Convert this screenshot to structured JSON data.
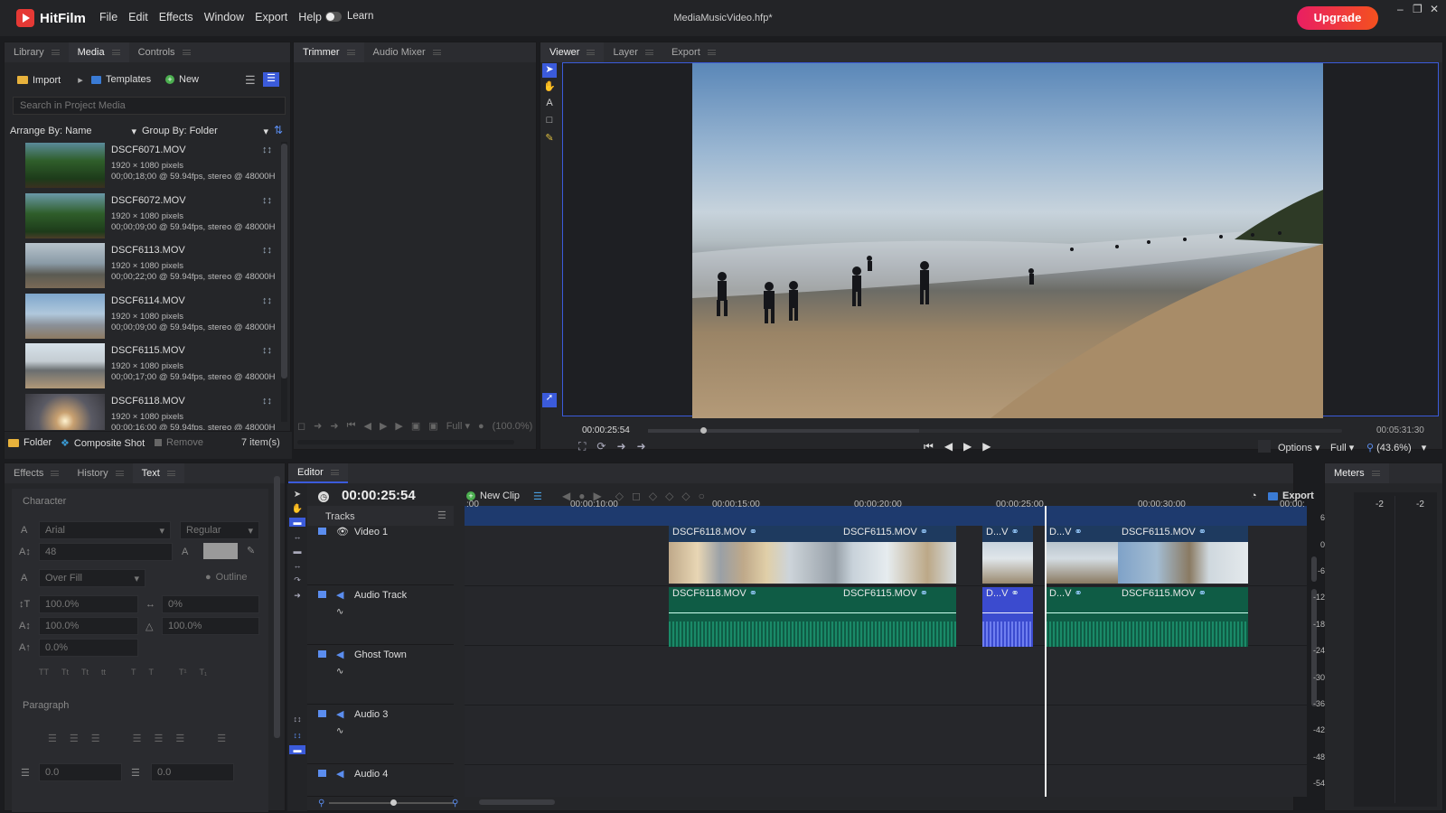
{
  "app": {
    "name": "HitFilm",
    "document": "MediaMusicVideo.hfp*",
    "upgrade": "Upgrade",
    "learn": "Learn"
  },
  "menu": [
    "File",
    "Edit",
    "Effects",
    "Window",
    "Export",
    "Help"
  ],
  "media_panel": {
    "tabs": [
      "Library",
      "Media",
      "Controls"
    ],
    "import": "Import",
    "templates": "Templates",
    "new": "New",
    "search_placeholder": "Search in Project Media",
    "arrange": "Arrange By: Name",
    "group": "Group By: Folder",
    "items": [
      {
        "name": "DSCF6071.MOV",
        "res": "1920 × 1080 pixels",
        "info": "00;00;18;00 @ 59.94fps, stereo @ 48000H"
      },
      {
        "name": "DSCF6072.MOV",
        "res": "1920 × 1080 pixels",
        "info": "00;00;09;00 @ 59.94fps, stereo @ 48000H"
      },
      {
        "name": "DSCF6113.MOV",
        "res": "1920 × 1080 pixels",
        "info": "00;00;22;00 @ 59.94fps, stereo @ 48000H"
      },
      {
        "name": "DSCF6114.MOV",
        "res": "1920 × 1080 pixels",
        "info": "00;00;09;00 @ 59.94fps, stereo @ 48000H"
      },
      {
        "name": "DSCF6115.MOV",
        "res": "1920 × 1080 pixels",
        "info": "00;00;17;00 @ 59.94fps, stereo @ 48000H"
      },
      {
        "name": "DSCF6118.MOV",
        "res": "1920 × 1080 pixels",
        "info": "00;00;16;00 @ 59.94fps, stereo @ 48000H"
      }
    ],
    "footer": {
      "folder": "Folder",
      "composite": "Composite Shot",
      "remove": "Remove",
      "count": "7 item(s)"
    }
  },
  "trimmer": {
    "tabs": [
      "Trimmer",
      "Audio Mixer"
    ],
    "quality": "Full",
    "zoom": "(100.0%)"
  },
  "viewer": {
    "tabs": [
      "Viewer",
      "Layer",
      "Export"
    ],
    "time_current": "00:00:25:54",
    "time_total": "00:05:31:30",
    "scrub_position": 0.08,
    "options": "Options",
    "quality": "Full",
    "zoom": "(43.6%)"
  },
  "text_panel": {
    "tabs": [
      "Effects",
      "History",
      "Text"
    ],
    "character": "Character",
    "font": "Arial",
    "style": "Regular",
    "size": "48",
    "fill": "Over Fill",
    "outline": "Outline",
    "scale_v": "100.0%",
    "tracking": "0%",
    "scale_h": "100.0%",
    "opacity": "100.0%",
    "baseline": "0.0%",
    "paragraph": "Paragraph",
    "indent_left": "0.0",
    "space_before": "0.0"
  },
  "editor": {
    "tab": "Editor",
    "timecode": "00:00:25:54",
    "new_clip": "New Clip",
    "export": "Export",
    "tracks": "Tracks",
    "ruler": [
      ":00",
      "00:00:10:00",
      "00:00:15:00",
      "00:00:20:00",
      "00:00:25:00",
      "00:00:30:00",
      "00:00:"
    ],
    "track_names": [
      "Video 1",
      "Audio Track",
      "Ghost Town",
      "Audio 3",
      "Audio 4"
    ],
    "video_clips": [
      "DSCF6118.MOV",
      "DSCF6115.MOV",
      "D...V",
      "D...V",
      "DSCF6115.MOV"
    ],
    "audio_clips": [
      "DSCF6118.MOV",
      "DSCF6115.MOV",
      "D...V",
      "D...V",
      "DSCF6115.MOV"
    ]
  },
  "meters": {
    "tab": "Meters",
    "channels": [
      "-2",
      "-2"
    ],
    "scale": [
      "6",
      "0",
      "-6",
      "-12",
      "-18",
      "-24",
      "-30",
      "-36",
      "-42",
      "-48",
      "-54"
    ]
  },
  "colors": {
    "accent": "#3b5bdb",
    "audio_clip": "#0f5c45",
    "video_clip_header": "#1e3a5f",
    "upgrade_start": "#e91e63",
    "upgrade_end": "#f4511e"
  }
}
